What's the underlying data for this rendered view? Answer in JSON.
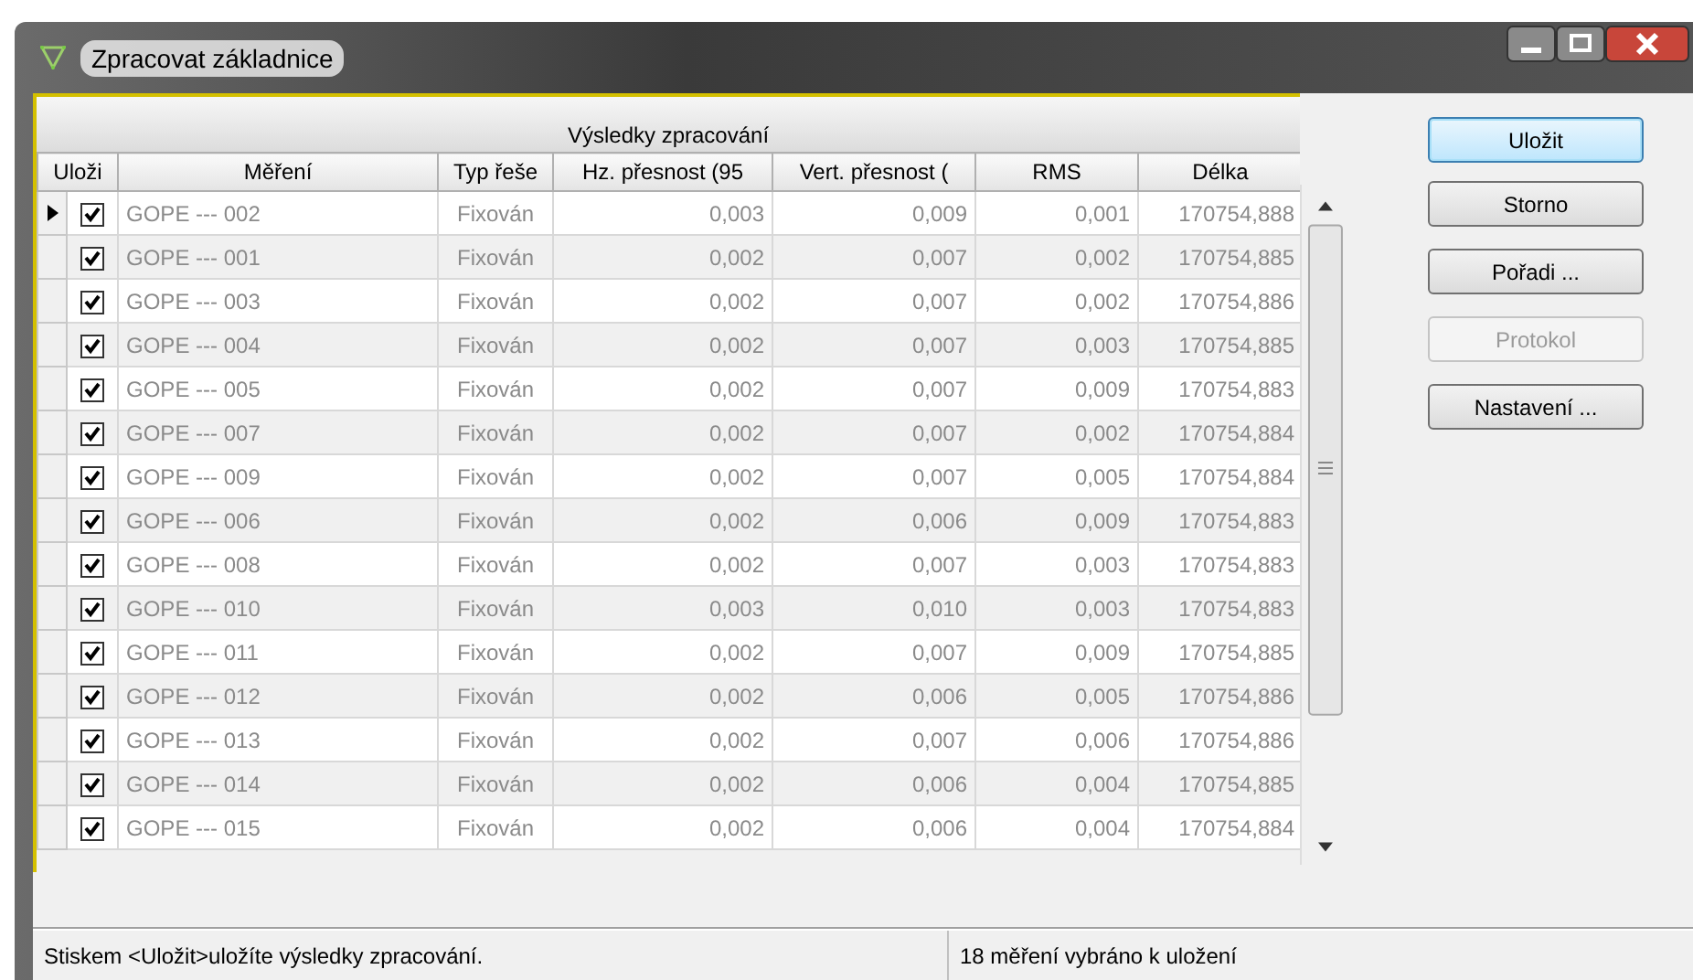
{
  "window": {
    "title": "Zpracovat základnice"
  },
  "grid": {
    "group_header": "Výsledky zpracování",
    "columns": [
      "Uloži",
      "Měření",
      "Typ řeše",
      "Hz. přesnost (95",
      "Vert. přesnost (",
      "RMS",
      "Délka"
    ],
    "rows": [
      {
        "current": true,
        "checked": true,
        "name": "GOPE --- 002",
        "type": "Fixován",
        "hz": "0,003",
        "vert": "0,009",
        "rms": "0,001",
        "length": "170754,888"
      },
      {
        "current": false,
        "checked": true,
        "name": "GOPE --- 001",
        "type": "Fixován",
        "hz": "0,002",
        "vert": "0,007",
        "rms": "0,002",
        "length": "170754,885"
      },
      {
        "current": false,
        "checked": true,
        "name": "GOPE --- 003",
        "type": "Fixován",
        "hz": "0,002",
        "vert": "0,007",
        "rms": "0,002",
        "length": "170754,886"
      },
      {
        "current": false,
        "checked": true,
        "name": "GOPE --- 004",
        "type": "Fixován",
        "hz": "0,002",
        "vert": "0,007",
        "rms": "0,003",
        "length": "170754,885"
      },
      {
        "current": false,
        "checked": true,
        "name": "GOPE --- 005",
        "type": "Fixován",
        "hz": "0,002",
        "vert": "0,007",
        "rms": "0,009",
        "length": "170754,883"
      },
      {
        "current": false,
        "checked": true,
        "name": "GOPE --- 007",
        "type": "Fixován",
        "hz": "0,002",
        "vert": "0,007",
        "rms": "0,002",
        "length": "170754,884"
      },
      {
        "current": false,
        "checked": true,
        "name": "GOPE --- 009",
        "type": "Fixován",
        "hz": "0,002",
        "vert": "0,007",
        "rms": "0,005",
        "length": "170754,884"
      },
      {
        "current": false,
        "checked": true,
        "name": "GOPE --- 006",
        "type": "Fixován",
        "hz": "0,002",
        "vert": "0,006",
        "rms": "0,009",
        "length": "170754,883"
      },
      {
        "current": false,
        "checked": true,
        "name": "GOPE --- 008",
        "type": "Fixován",
        "hz": "0,002",
        "vert": "0,007",
        "rms": "0,003",
        "length": "170754,883"
      },
      {
        "current": false,
        "checked": true,
        "name": "GOPE --- 010",
        "type": "Fixován",
        "hz": "0,003",
        "vert": "0,010",
        "rms": "0,003",
        "length": "170754,883"
      },
      {
        "current": false,
        "checked": true,
        "name": "GOPE --- 011",
        "type": "Fixován",
        "hz": "0,002",
        "vert": "0,007",
        "rms": "0,009",
        "length": "170754,885"
      },
      {
        "current": false,
        "checked": true,
        "name": "GOPE --- 012",
        "type": "Fixován",
        "hz": "0,002",
        "vert": "0,006",
        "rms": "0,005",
        "length": "170754,886"
      },
      {
        "current": false,
        "checked": true,
        "name": "GOPE --- 013",
        "type": "Fixován",
        "hz": "0,002",
        "vert": "0,007",
        "rms": "0,006",
        "length": "170754,886"
      },
      {
        "current": false,
        "checked": true,
        "name": "GOPE --- 014",
        "type": "Fixován",
        "hz": "0,002",
        "vert": "0,006",
        "rms": "0,004",
        "length": "170754,885"
      },
      {
        "current": false,
        "checked": true,
        "name": "GOPE --- 015",
        "type": "Fixován",
        "hz": "0,002",
        "vert": "0,006",
        "rms": "0,004",
        "length": "170754,884"
      }
    ]
  },
  "buttons": [
    {
      "label": "Uložit",
      "default": true,
      "disabled": false
    },
    {
      "label": "Storno",
      "default": false,
      "disabled": false
    },
    {
      "label": "Pořadi ...",
      "default": false,
      "disabled": false
    },
    {
      "label": "Protokol",
      "default": false,
      "disabled": true
    },
    {
      "label": "Nastavení ...",
      "default": false,
      "disabled": false
    }
  ],
  "status_bar": {
    "message": "Stiskem <Uložit>uložíte výsledky zpracování.",
    "count": "18 měření vybráno k uložení"
  }
}
